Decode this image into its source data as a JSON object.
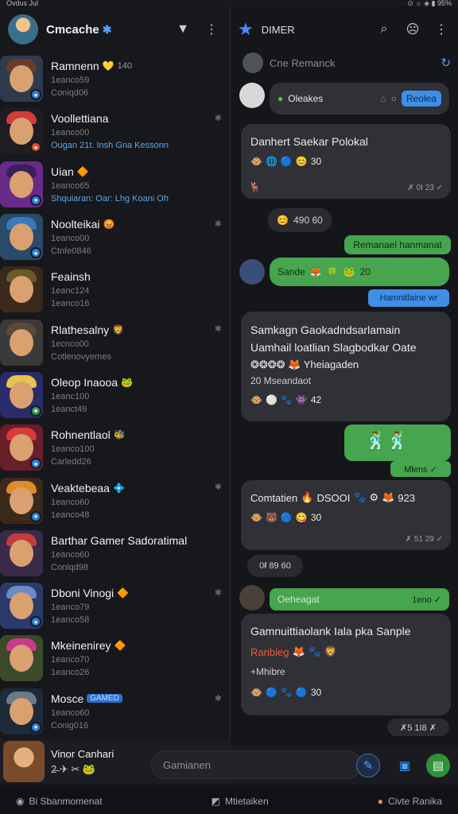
{
  "status": {
    "left": "Ovdus Jul",
    "right": "⊙ ☼ ◈ ▮ 95%"
  },
  "left": {
    "header": {
      "name": "Cmcache",
      "verified": "✱"
    },
    "chats": [
      {
        "name": "Ramnenn",
        "emoji": "💛",
        "extra": "140",
        "line1": "1eanco59",
        "line2": "Coniqd06",
        "badge": "#2b7fe0"
      },
      {
        "name": "Voollettiana",
        "emoji": "",
        "extra": "",
        "line1": "1eanco00",
        "line2": "Ougan 21t. Insh Gna Kessonn",
        "link": true,
        "badge": "#e0502b",
        "pin": true
      },
      {
        "name": "Uian",
        "emoji": "🔶",
        "extra": "",
        "line1": "1eanco65",
        "line2": "Shquiaran: Oar: Lhg Koani Oh",
        "link": true,
        "badge": "#2b7fe0"
      },
      {
        "name": "Noolteikai",
        "emoji": "😡",
        "extra": "",
        "line1": "1eanco00",
        "line2": "Ctnfe0846",
        "badge": "#2b7fe0",
        "pin": true
      },
      {
        "name": "Feainsh",
        "emoji": "",
        "extra": "",
        "line1": "1eanc124",
        "line2": "1eanco16",
        "badge": ""
      },
      {
        "name": "Rlathesalny",
        "emoji": "🦁",
        "extra": "",
        "line1": "1ecnco00",
        "line2": "Cotlenovyemes",
        "badge": "",
        "pin": true
      },
      {
        "name": "Oleop Inaooa",
        "emoji": "🐸",
        "extra": "",
        "line1": "1eanc100",
        "line2": "1eanct49",
        "badge": "#33a05a"
      },
      {
        "name": "Rohnentlaol",
        "emoji": "🐝",
        "extra": "",
        "line1": "1eanco100",
        "line2": "Carledd26",
        "badge": "#2b7fe0"
      },
      {
        "name": "Veaktebeaa",
        "emoji": "💠",
        "extra": "",
        "line1": "1eanco60",
        "line2": "1eanco48",
        "badge": "#2b7fe0",
        "pin": true
      },
      {
        "name": "Barthar Gamer Sadoratimal",
        "emoji": "",
        "extra": "",
        "line1": "1eanco60",
        "line2": "Coniqd98",
        "badge": ""
      },
      {
        "name": "Dboni Vinogi",
        "emoji": "🔶",
        "extra": "",
        "line1": "1eanco79",
        "line2": "1eanco58",
        "badge": "#2b7fe0",
        "pin": true
      },
      {
        "name": "Mkeinenirey",
        "emoji": "🔶",
        "extra": "",
        "line1": "1eanco70",
        "line2": "1eanco26",
        "badge": ""
      },
      {
        "name": "Mosce",
        "emoji": "",
        "extra": "",
        "tag": "GAMED",
        "line1": "1eanco60",
        "line2": "Conig016",
        "badge": "#2b7fe0",
        "pin": true
      }
    ],
    "footer": {
      "name": "Vinor Canhari",
      "icons": "2̶ ✈ ✂ 🐸"
    }
  },
  "right": {
    "header": {
      "title": "DIMER"
    },
    "search_placeholder": "Cne Remanck",
    "messages": {
      "m1": {
        "label": "Oleakes",
        "pill": "Reolea"
      },
      "m2": {
        "title": "Danhert Saekar Polokal",
        "count": "30",
        "time": "✗ 0I 23 ✓"
      },
      "m3": {
        "text": "490 60"
      },
      "m4": {
        "text": "Remanael hanmanat"
      },
      "m5": {
        "label": "Sande",
        "count": "20"
      },
      "m6": {
        "text": "Hamnitlaine wr"
      },
      "m7": {
        "title1": "Samkagn Gaokadndsarlamain",
        "title2": "Uamhail loatlian Slagbodkar Oate",
        "title3": "Yheiagaden",
        "sub": "20 Mseandaot",
        "count": "42"
      },
      "m8": {
        "time": "Mlens ✓"
      },
      "m9": {
        "title": "Comtatien",
        "code": "DSOOI",
        "count": "30",
        "extra": "923",
        "time": "✗ 51 29 ✓"
      },
      "m10": {
        "text": "0ᵮ 89 60"
      },
      "m11": {
        "label": "Oeheagat",
        "time": "1eno ✓"
      },
      "m12": {
        "title": "Gamnuittiaolank Iala pka Sanple",
        "red": "Ranbieg",
        "sub": "+Mhibre",
        "count": "30"
      },
      "m13": {
        "time": "✗5 1I8 ✗"
      }
    }
  },
  "composer": {
    "placeholder": "Gamianen"
  },
  "bottombar": {
    "items": [
      "Bi Sbanmomenat",
      "Mtietaiken",
      "Civte Ranika"
    ]
  }
}
